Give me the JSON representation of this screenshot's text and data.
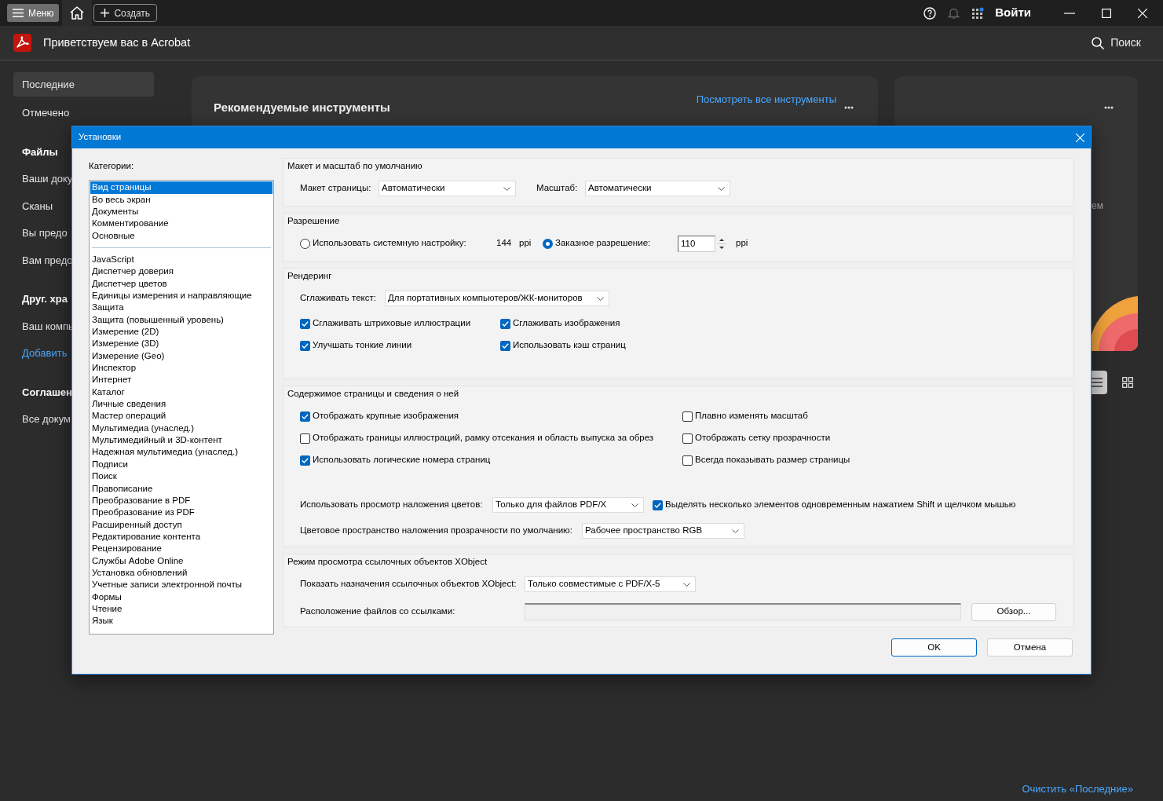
{
  "titlebar": {
    "menu_button": "Меню",
    "create_button": "Создать",
    "sign_in_button": "Войти"
  },
  "header": {
    "title": "Приветствуем вас в Acrobat",
    "search_button": "Поиск"
  },
  "sidebar": [
    {
      "kind": "item",
      "label": "Последние",
      "selected": true
    },
    {
      "kind": "item",
      "label": "Отмечено",
      "selected": false
    },
    {
      "kind": "heading",
      "label": "Файлы"
    },
    {
      "kind": "item",
      "label": "Ваши доку",
      "selected": false
    },
    {
      "kind": "item",
      "label": "Сканы",
      "selected": false
    },
    {
      "kind": "item",
      "label": "Вы предо",
      "selected": false
    },
    {
      "kind": "item",
      "label": "Вам предо",
      "selected": false
    },
    {
      "kind": "heading",
      "label": "Друг. хра"
    },
    {
      "kind": "item",
      "label": "Ваш компь",
      "selected": false
    },
    {
      "kind": "link",
      "label": "Добавить",
      "selected": false
    },
    {
      "kind": "heading",
      "label": "Соглашен"
    },
    {
      "kind": "item",
      "label": "Все докум",
      "selected": false
    }
  ],
  "recommended_tools": {
    "title": "Рекомендуемые инструменты",
    "link": "Посмотреть все инструменты"
  },
  "side_card": {
    "text_fragment": "ем"
  },
  "view_toggle": [
    {
      "kind": "list",
      "selected": true
    },
    {
      "kind": "grid",
      "selected": false
    }
  ],
  "clear_recent_link": "Очистить «Последние»",
  "dialog": {
    "title": "Установки",
    "categories_label": "Категории:",
    "category_groups": [
      {
        "items": [
          {
            "label": "Вид страницы",
            "selected": true
          },
          {
            "label": "Во весь экран",
            "selected": false
          },
          {
            "label": "Документы",
            "selected": false
          },
          {
            "label": "Комментирование",
            "selected": false
          },
          {
            "label": "Основные",
            "selected": false
          }
        ]
      },
      {
        "items": [
          {
            "label": "JavaScript",
            "selected": false
          },
          {
            "label": "Диспетчер доверия",
            "selected": false
          },
          {
            "label": "Диспетчер цветов",
            "selected": false
          },
          {
            "label": "Единицы измерения и направляющие",
            "selected": false
          },
          {
            "label": "Защита",
            "selected": false
          },
          {
            "label": "Защита (повышенный уровень)",
            "selected": false
          },
          {
            "label": "Измерение (2D)",
            "selected": false
          },
          {
            "label": "Измерение (3D)",
            "selected": false
          },
          {
            "label": "Измерение (Geo)",
            "selected": false
          },
          {
            "label": "Инспектор",
            "selected": false
          },
          {
            "label": "Интернет",
            "selected": false
          },
          {
            "label": "Каталог",
            "selected": false
          },
          {
            "label": "Личные сведения",
            "selected": false
          },
          {
            "label": "Мастер операций",
            "selected": false
          },
          {
            "label": "Мультимедиа (унаслед.)",
            "selected": false
          },
          {
            "label": "Мультимедийный и 3D-контент",
            "selected": false
          },
          {
            "label": "Надежная мультимедиа (унаслед.)",
            "selected": false
          },
          {
            "label": "Подписи",
            "selected": false
          },
          {
            "label": "Поиск",
            "selected": false
          },
          {
            "label": "Правописание",
            "selected": false
          },
          {
            "label": "Преобразование в PDF",
            "selected": false
          },
          {
            "label": "Преобразование из PDF",
            "selected": false
          },
          {
            "label": "Расширенный доступ",
            "selected": false
          },
          {
            "label": "Редактирование контента",
            "selected": false
          },
          {
            "label": "Рецензирование",
            "selected": false
          },
          {
            "label": "Службы Adobe Online",
            "selected": false
          },
          {
            "label": "Установка обновлений",
            "selected": false
          },
          {
            "label": "Учетные записи электронной почты",
            "selected": false
          },
          {
            "label": "Формы",
            "selected": false
          },
          {
            "label": "Чтение",
            "selected": false
          },
          {
            "label": "Язык",
            "selected": false
          }
        ]
      }
    ],
    "groups": [
      {
        "title": "Макет и масштаб по умолчанию",
        "rows": [
          {
            "kind": "controls",
            "items": [
              {
                "kind": "label",
                "text": "Макет страницы:"
              },
              {
                "kind": "select",
                "value": "Автоматически"
              },
              {
                "kind": "label",
                "text": "Масштаб:"
              },
              {
                "kind": "select",
                "value": "Автоматически"
              }
            ]
          }
        ]
      },
      {
        "title": "Разрешение",
        "rows": [
          {
            "kind": "controls",
            "items": [
              {
                "kind": "radio",
                "label": "Использовать системную настройку:",
                "selected": false
              },
              {
                "kind": "label",
                "text": "144"
              },
              {
                "kind": "label",
                "text": "ppi"
              },
              {
                "kind": "radio",
                "label": "Заказное разрешение:",
                "selected": true
              },
              {
                "kind": "spin",
                "value": "110"
              },
              {
                "kind": "label",
                "text": "ppi"
              }
            ]
          }
        ]
      },
      {
        "title": "Рендеринг",
        "rows": [
          {
            "kind": "controls",
            "items": [
              {
                "kind": "label",
                "text": "Сглаживать текст:"
              },
              {
                "kind": "select",
                "value": "Для портативных компьютеров/ЖК-мониторов"
              }
            ]
          },
          {
            "kind": "checks",
            "items": [
              {
                "label": "Сглаживать штриховые иллюстрации",
                "checked": true
              },
              {
                "label": "Сглаживать изображения",
                "checked": true
              },
              {
                "label": "Улучшать тонкие линии",
                "checked": true
              },
              {
                "label": "Использовать кэш страниц",
                "checked": true
              }
            ]
          }
        ]
      },
      {
        "title": "Содержимое страницы и сведения о ней",
        "rows": [
          {
            "kind": "checks",
            "items": [
              {
                "label": "Отображать крупные изображения",
                "checked": true
              },
              {
                "label": "Плавно изменять масштаб",
                "checked": false
              },
              {
                "label": "Отображать границы иллюстраций, рамку отсекания и область выпуска за обрез",
                "checked": false
              },
              {
                "label": "Отображать сетку прозрачности",
                "checked": false
              },
              {
                "label": "Использовать логические номера страниц",
                "checked": true
              },
              {
                "label": "Всегда показывать размер страницы",
                "checked": false
              }
            ]
          },
          {
            "kind": "controls",
            "items": [
              {
                "kind": "label",
                "text": "Использовать просмотр наложения цветов:"
              },
              {
                "kind": "select",
                "value": "Только для файлов PDF/X"
              },
              {
                "kind": "checkbox",
                "label": "Выделять несколько элементов одновременным нажатием Shift и щелчком мышью",
                "checked": true
              }
            ]
          },
          {
            "kind": "controls",
            "items": [
              {
                "kind": "label",
                "text": "Цветовое пространство наложения прозрачности по умолчанию:"
              },
              {
                "kind": "select",
                "value": "Рабочее пространство RGB"
              }
            ]
          }
        ]
      },
      {
        "title": "Режим просмотра ссылочных объектов XObject",
        "rows": [
          {
            "kind": "controls",
            "items": [
              {
                "kind": "label",
                "text": "Показать назначения ссылочных объектов XObject:"
              },
              {
                "kind": "select",
                "value": "Только совместимые с PDF/X-5"
              }
            ]
          },
          {
            "kind": "controls",
            "items": [
              {
                "kind": "label",
                "text": "Расположение файлов со ссылками:"
              },
              {
                "kind": "path"
              },
              {
                "kind": "button",
                "label": "Обзор..."
              }
            ]
          }
        ]
      }
    ],
    "buttons": [
      {
        "label": "OK",
        "default": true
      },
      {
        "label": "Отмена",
        "default": false
      }
    ]
  }
}
